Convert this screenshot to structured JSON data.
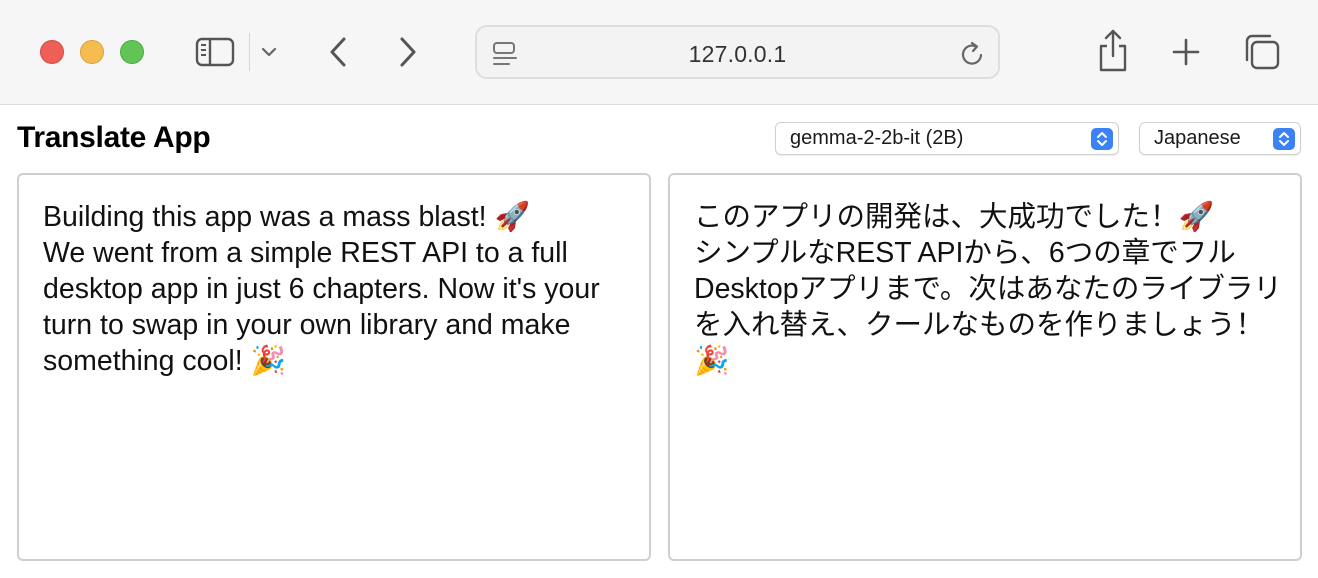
{
  "browser": {
    "url": "127.0.0.1",
    "icons": {
      "sidebar": "sidebar-icon",
      "chevron": "chevron-down-icon",
      "back": "back-arrow-icon",
      "forward": "forward-arrow-icon",
      "page": "page-menu-icon",
      "reload": "reload-icon",
      "share": "share-icon",
      "new_tab": "plus-icon",
      "tabs": "tab-overview-icon"
    }
  },
  "app": {
    "title": "Translate App",
    "model_select": {
      "selected": "gemma-2-2b-it (2B)"
    },
    "language_select": {
      "selected": "Japanese"
    },
    "input_text": "Building this app was a mass blast! 🚀\nWe went from a simple REST API to a full desktop app in just 6 chapters. Now it's your turn to swap in your own library and make something cool! 🎉",
    "output_text": "このアプリの開発は、大成功でした！🚀\nシンプルなREST APIから、6つの章でフルDesktopアプリまで。次はあなたのライブラリを入れ替え、クールなものを作りましょう！🎉"
  },
  "colors": {
    "accent": "#3b82f6",
    "traffic_red": "#ee5f57",
    "traffic_yellow": "#f5bd4f",
    "traffic_green": "#61c454"
  }
}
